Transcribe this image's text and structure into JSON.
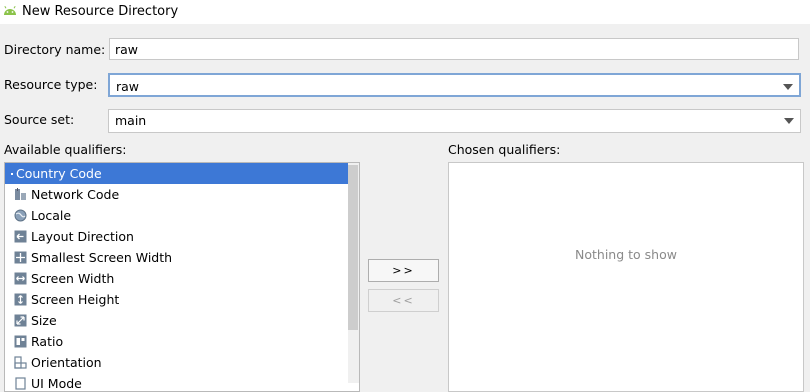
{
  "window": {
    "title": "New Resource Directory",
    "app_icon": "android-icon"
  },
  "form": {
    "directory_name": {
      "label": "Directory name:",
      "value": "raw"
    },
    "resource_type": {
      "label": "Resource type:",
      "value": "raw"
    },
    "source_set": {
      "label": "Source set:",
      "value": "main"
    }
  },
  "available": {
    "label": "Available qualifiers:",
    "items": [
      {
        "label": "Country Code",
        "icon": "country-code-icon"
      },
      {
        "label": "Network Code",
        "icon": "network-code-icon"
      },
      {
        "label": "Locale",
        "icon": "globe-icon"
      },
      {
        "label": "Layout Direction",
        "icon": "layout-direction-icon"
      },
      {
        "label": "Smallest Screen Width",
        "icon": "smallest-screen-width-icon"
      },
      {
        "label": "Screen Width",
        "icon": "screen-width-icon"
      },
      {
        "label": "Screen Height",
        "icon": "screen-height-icon"
      },
      {
        "label": "Size",
        "icon": "size-icon"
      },
      {
        "label": "Ratio",
        "icon": "ratio-icon"
      },
      {
        "label": "Orientation",
        "icon": "orientation-icon"
      },
      {
        "label": "UI Mode",
        "icon": "ui-mode-icon"
      }
    ]
  },
  "buttons": {
    "add": ">>",
    "remove": "<<"
  },
  "chosen": {
    "label": "Chosen qualifiers:",
    "empty_text": "Nothing to show"
  },
  "colors": {
    "selection": "#3d78d6",
    "focus_border": "#7fa6d6"
  }
}
